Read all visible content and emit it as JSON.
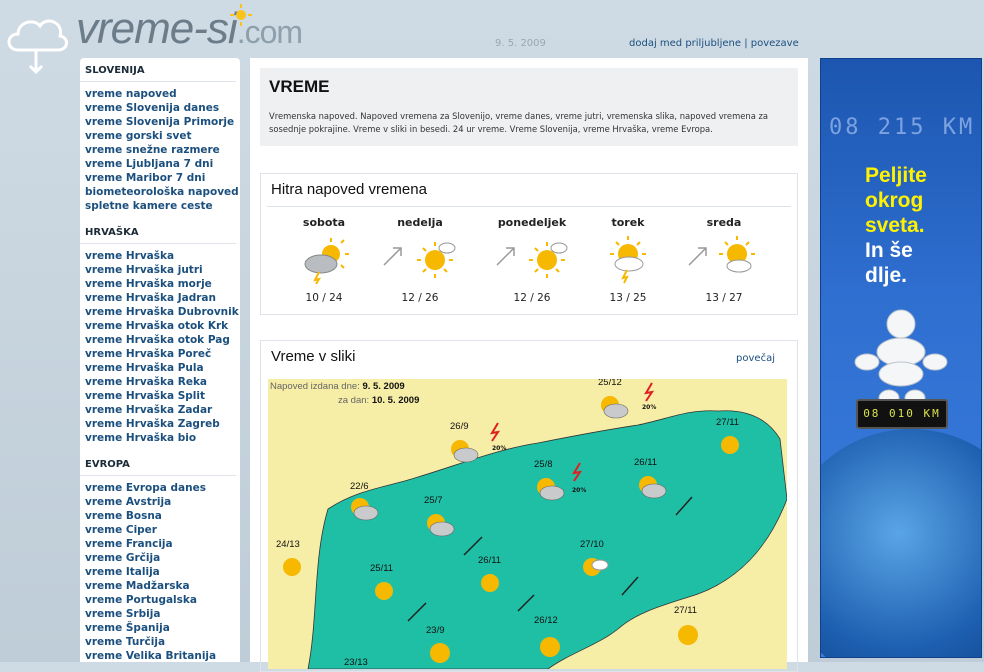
{
  "header": {
    "logo_text": "vreme-si",
    "logo_domain": ".com",
    "date": "9. 5. 2009",
    "links": [
      "dodaj med priljubljene",
      "povezave"
    ],
    "link_separator": "|"
  },
  "sidebar": {
    "sections": [
      {
        "title": "SLOVENIJA",
        "items": [
          "vreme napoved",
          "vreme Slovenija danes",
          "vreme Slovenija Primorje",
          "vreme gorski svet",
          "vreme snežne razmere",
          "vreme Ljubljana 7 dni",
          "vreme Maribor 7 dni",
          "biometeorološka napoved",
          "spletne kamere ceste"
        ]
      },
      {
        "title": "HRVAŠKA",
        "items": [
          "vreme Hrvaška",
          "vreme Hrvaška jutri",
          "vreme Hrvaška morje",
          "vreme Hrvaška Jadran",
          "vreme Hrvaška Dubrovnik",
          "vreme Hrvaška otok Krk",
          "vreme Hrvaška otok Pag",
          "vreme Hrvaška Poreč",
          "vreme Hrvaška Pula",
          "vreme Hrvaška Reka",
          "vreme Hrvaška Split",
          "vreme Hrvaška Zadar",
          "vreme Hrvaška Zagreb",
          "vreme Hrvaška bio"
        ]
      },
      {
        "title": "EVROPA",
        "items": [
          "vreme Evropa danes",
          "vreme Avstrija",
          "vreme Bosna",
          "vreme Ciper",
          "vreme Francija",
          "vreme Grčija",
          "vreme Italija",
          "vreme Madžarska",
          "vreme Portugalska",
          "vreme Srbija",
          "vreme Španija",
          "vreme Turčija",
          "vreme Velika Britanija"
        ]
      }
    ]
  },
  "intro": {
    "title": "VREME",
    "text": "Vremenska napoved. Napoved vremena za Slovenijo, vreme danes, vreme jutri, vremenska slika, napoved vremena za sosednje pokrajine. Vreme v sliki in besedi. 24 ur vreme. Vreme Slovenija, vreme Hrvaška, vreme Evropa."
  },
  "quick": {
    "title": "Hitra napoved vremena",
    "days": [
      {
        "name": "sobota",
        "temp": "10 / 24",
        "icon": "storm-cloud-sun-icon"
      },
      {
        "name": "nedelja",
        "temp": "12 / 26",
        "icon": "sun-cloud-icon"
      },
      {
        "name": "ponedeljek",
        "temp": "12 / 26",
        "icon": "sun-cloud-icon"
      },
      {
        "name": "torek",
        "temp": "13 / 25",
        "icon": "sun-cloud-lightning-icon"
      },
      {
        "name": "sreda",
        "temp": "13 / 27",
        "icon": "sun-cloud-icon"
      }
    ]
  },
  "map": {
    "title": "Vreme v sliki",
    "enlarge": "povečaj",
    "issued_label": "Napoved izdana dne:",
    "issued_date": "9. 5. 2009",
    "for_label": "za dan:",
    "for_date": "10. 5. 2009",
    "temps": [
      "25/12",
      "26/9",
      "25/8",
      "26/11",
      "27/11",
      "22/6",
      "25/7",
      "24/13",
      "25/11",
      "26/11",
      "27/10",
      "27/11",
      "23/9",
      "26/12",
      "23/13"
    ],
    "storm_pct": [
      "20%",
      "20%",
      "20%"
    ],
    "colors": {
      "land": "#1fbfa6",
      "background": "#f6eda6"
    }
  },
  "ad": {
    "counter": "08 215 KM",
    "slogan_line1": "Peljite",
    "slogan_line2": "okrog",
    "slogan_line3": "sveta.",
    "slogan_line4": "In še",
    "slogan_line5": "dlje.",
    "odometer": "08 010 KM"
  }
}
